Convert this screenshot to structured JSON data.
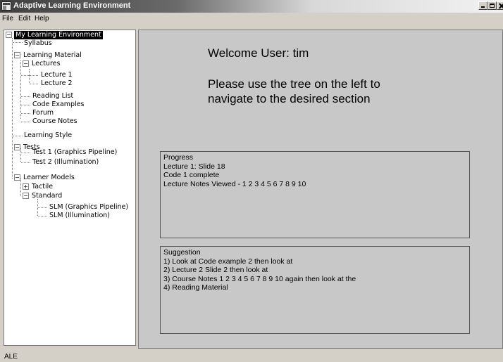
{
  "window": {
    "title": "Adaptive Learning Environment"
  },
  "menu": [
    "File",
    "Edit",
    "Help"
  ],
  "tree": {
    "root": "My Learning Environment",
    "syllabus": "Syllabus",
    "learning_material": "Learning Material",
    "lectures": "Lectures",
    "lecture1": "Lecture 1",
    "lecture2": "Lecture 2",
    "reading_list": "Reading List",
    "code_examples": "Code Examples",
    "forum": "Forum",
    "course_notes": "Course Notes",
    "learning_style": "Learning Style",
    "tests": "Tests",
    "test1": "Test 1 (Graphics Pipeline)",
    "test2": "Test 2 (Illumination)",
    "learner_models": "Learner Models",
    "tactile": "Tactile",
    "standard": "Standard",
    "slm1": "SLM (Graphics Pipeline)",
    "slm2": "SLM (Illumination)"
  },
  "main": {
    "welcome": "Welcome User: tim",
    "instruction": "Please use the tree on the left to navigate to the desired section",
    "progress": {
      "title": "Progress",
      "lines": [
        "Lecture 1: Slide 18",
        "Code 1 complete",
        "Lecture Notes Viewed - 1 2 3 4 5 6 7 8 9 10"
      ]
    },
    "suggestion": {
      "title": "Suggestion",
      "lines": [
        "1) Look at Code example 2 then look at",
        "2) Lecture 2 Slide 2 then look at",
        "3) Course Notes 1 2 3 4 5 6 7 8 9 10  again then look at the",
        "4) Reading Material"
      ]
    }
  },
  "status": {
    "text": "ALE"
  },
  "colors": {
    "window_bg": "#d4d0c8",
    "content_bg": "#c8c8c8",
    "tree_bg": "#ffffff",
    "selection": "#000000"
  }
}
